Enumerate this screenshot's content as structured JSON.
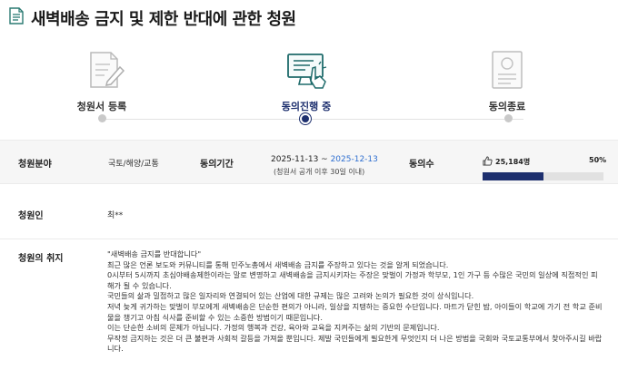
{
  "page": {
    "title": "새벽배송 금지 및 제한 반대에 관한 청원"
  },
  "steps": [
    {
      "label": "청원서 등록",
      "icon": "document-pen-icon",
      "state": "done"
    },
    {
      "label": "동의진행 중",
      "icon": "monitor-click-icon",
      "state": "active"
    },
    {
      "label": "동의종료",
      "icon": "certificate-icon",
      "state": "pending"
    }
  ],
  "info": {
    "field_label": "청원분야",
    "field_value": "국토/해양/교통",
    "period_label": "동의기간",
    "period_start": "2025-11-13",
    "period_sep": " ~ ",
    "period_end": "2025-12-13",
    "period_note": "(청원서 공개 이후 30일 이내)",
    "agree_label": "동의수",
    "agree_count": "25,184명",
    "agree_percent_text": "50%",
    "agree_progress": 0.5
  },
  "petitioner": {
    "label": "청원인",
    "value": "최**"
  },
  "purpose": {
    "label": "청원의 취지",
    "paragraphs": [
      "\"새벽배송 금지를 반대합니다\"",
      "최근 많은 언론 보도와 커뮤니티를 통해 민주노총에서 새벽배송 금지를 주장하고 있다는 것을 알게 되었습니다.",
      "0시부터 5시까지 초심야배송제한이라는 말로 변명하고 새벽배송을 금지시키자는 주장은 맞벌이 가정과 학부모, 1인 가구 등 수많은 국민의 일상에 직접적인 피해가 될 수 있습니다.",
      "국민들의 삶과 밀접하고 많은 일자리와 연결되어 있는 산업에 대한 규제는 많은 고려와 논의가 필요한 것이 상식입니다.",
      "저녁 늦게 귀가하는 맞벌이 부모에게 새벽배송은 단순한 편의가 아니라, 일상을 지탱하는 중요한 수단입니다. 마트가 닫힌 밤, 아이들이 학교에 가기 전 학교 준비물을 챙기고 아침 식사를 준비할 수 있는 소중한 방법이기 때문입니다.",
      "이는 단순한 소비의 문제가 아닙니다. 가정의 행복과 건강, 육아와 교육을 지켜주는 삶의 기반의 문제입니다.",
      "무작정 금지하는 것은 더 큰 불편과 사회적 갈등을 가져올 뿐입니다. 제발 국민들에게 필요한게 무엇인지 더 나은 방법을 국회와 국토교통부에서 찾아주시길 바랍니다."
    ]
  },
  "colors": {
    "accent": "#1d2f6e",
    "link_blue": "#2f6fd0",
    "progress_track": "#e1e1e1",
    "row_bg": "#f6f6f6"
  }
}
